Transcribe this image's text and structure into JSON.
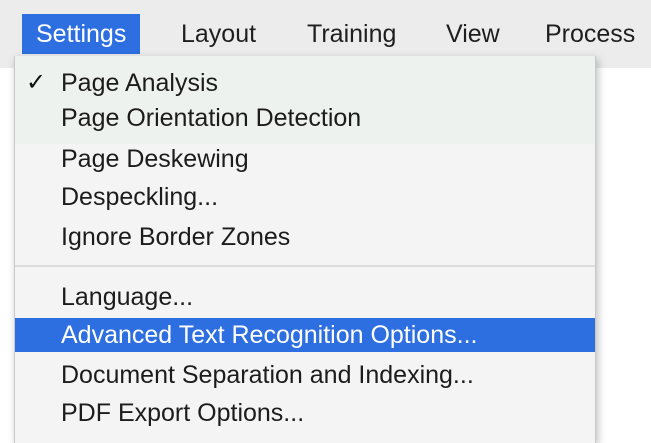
{
  "menubar": {
    "items": [
      {
        "label": "Settings",
        "active": true
      },
      {
        "label": "Layout"
      },
      {
        "label": "Training"
      },
      {
        "label": "View"
      },
      {
        "label": "Process"
      }
    ]
  },
  "dropdown": {
    "sections": [
      {
        "items": [
          {
            "label": "Page Analysis",
            "checked": true,
            "check_glyph": "✓"
          },
          {
            "label": "Page Orientation Detection"
          },
          {
            "label": "Page Deskewing"
          },
          {
            "label": "Despeckling..."
          },
          {
            "label": "Ignore Border Zones"
          }
        ]
      },
      {
        "items": [
          {
            "label": "Language..."
          },
          {
            "label": "Advanced Text Recognition Options...",
            "highlighted": true
          },
          {
            "label": "Document Separation and Indexing..."
          },
          {
            "label": "PDF Export Options..."
          }
        ]
      }
    ]
  },
  "colors": {
    "highlight": "#2d6fe0",
    "menubar_bg": "#ececec",
    "menu_bg": "#f4f4f4"
  }
}
